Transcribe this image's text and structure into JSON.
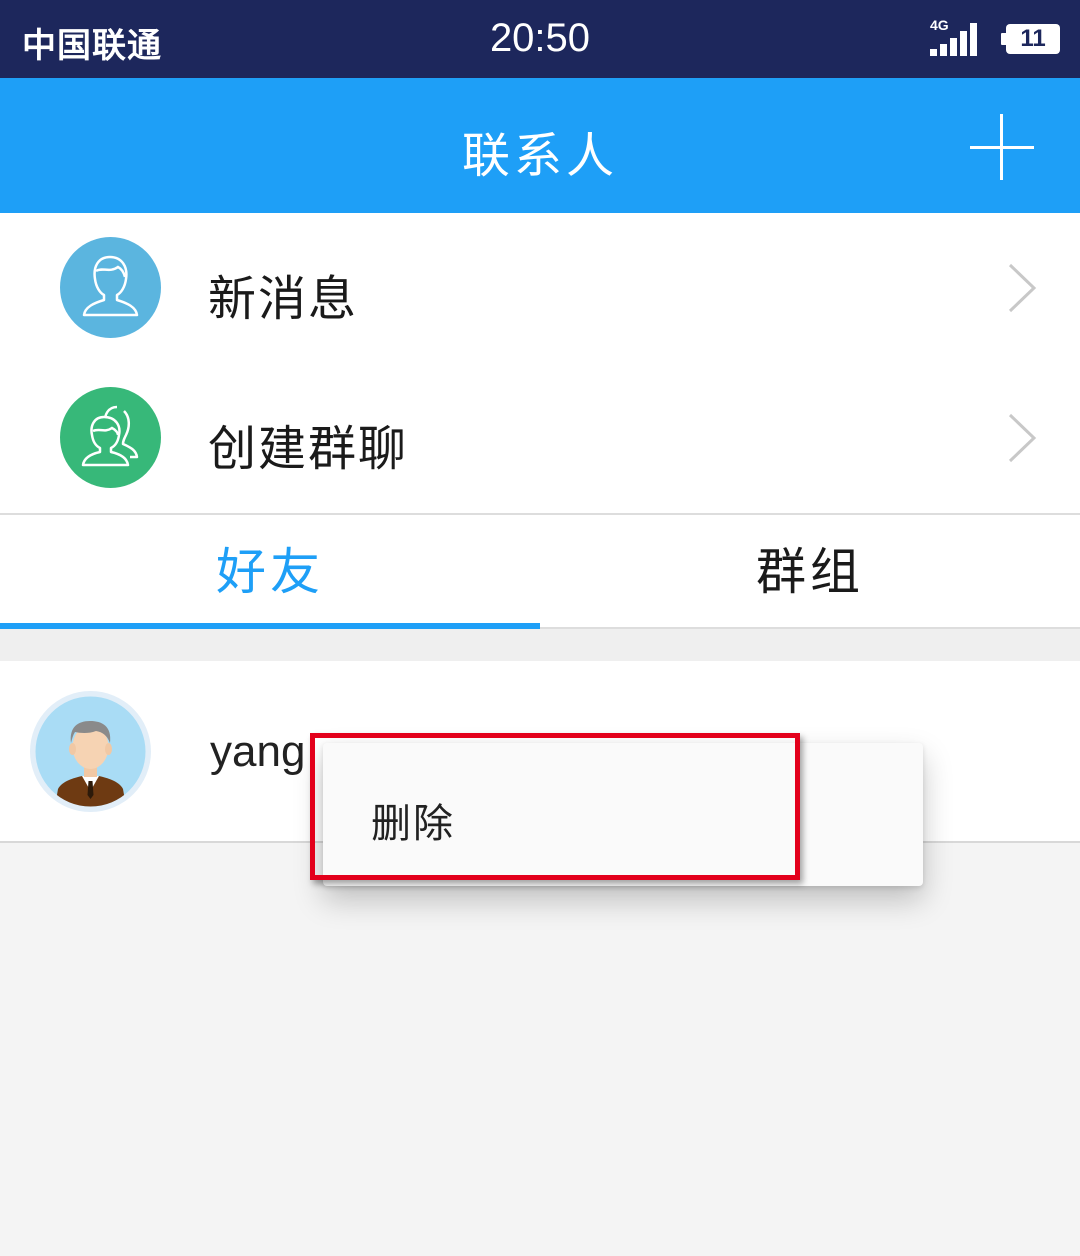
{
  "status_bar": {
    "carrier": "中国联通",
    "time": "20:50",
    "network": "4G",
    "battery": "11"
  },
  "header": {
    "title": "联系人",
    "add_icon": "plus-icon"
  },
  "menu": {
    "items": [
      {
        "label": "新消息",
        "icon": "person-icon",
        "icon_color": "#5bb5df"
      },
      {
        "label": "创建群聊",
        "icon": "group-icon",
        "icon_color": "#37b879"
      }
    ]
  },
  "tabs": [
    {
      "label": "好友",
      "active": true
    },
    {
      "label": "群组",
      "active": false
    }
  ],
  "friends": [
    {
      "name": "yang",
      "avatar": "man-avatar-icon"
    }
  ],
  "context_menu": {
    "items": [
      {
        "label": "删除"
      }
    ]
  },
  "colors": {
    "status_bar": "#1d275c",
    "accent": "#1e9ff7",
    "highlight": "#e3001b"
  }
}
